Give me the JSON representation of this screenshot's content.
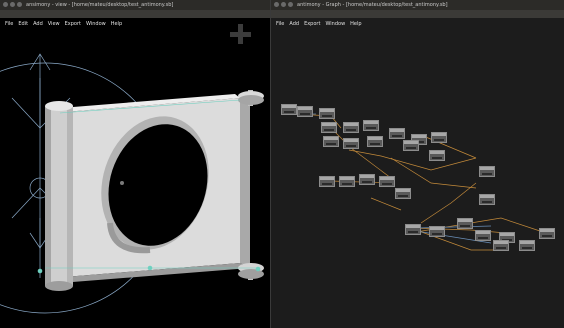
{
  "viewer_window": {
    "title": "ansimony - view - [home/mateu/desktop/test_antimony.sb]",
    "menu": [
      "File",
      "Edit",
      "Add",
      "View",
      "Export",
      "Window",
      "Help"
    ]
  },
  "graph_window": {
    "title": "antimony - Graph - [home/mateu/desktop/test_antimony.sb]",
    "menu": [
      "File",
      "Add",
      "Export",
      "Window",
      "Help"
    ]
  },
  "colors": {
    "viewport_bg": "#000000",
    "graph_bg": "#1c1c1c",
    "titlebar": "#2c2b28",
    "menubar": "#3b3a37",
    "model_surface": "#dcdcdc",
    "wire_orange": "#c38a3a",
    "wire_blue": "#6a8fb8",
    "axis_lines": "#8aa9c8"
  },
  "icons": {
    "window_close": "close-icon",
    "window_minimize": "minimize-icon",
    "window_maximize": "maximize-icon",
    "pan_cross": "pan-cross-icon"
  },
  "graph_node_count": 29
}
